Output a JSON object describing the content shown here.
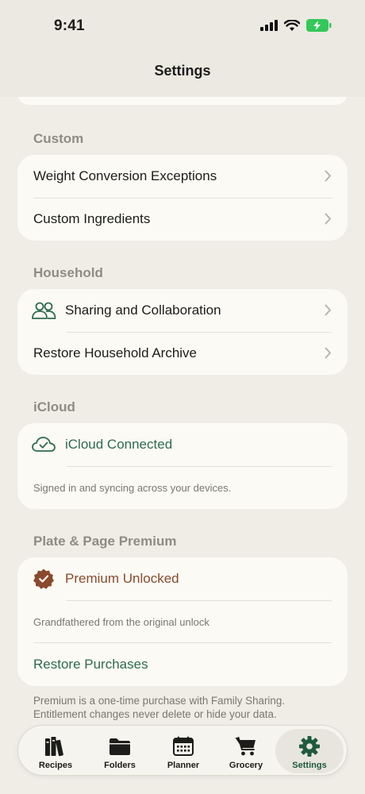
{
  "status": {
    "time": "9:41"
  },
  "nav": {
    "title": "Settings"
  },
  "sections": {
    "custom": {
      "header": "Custom",
      "rows": [
        "Weight Conversion Exceptions",
        "Custom Ingredients"
      ]
    },
    "household": {
      "header": "Household",
      "rows": [
        "Sharing and Collaboration",
        "Restore Household Archive"
      ]
    },
    "icloud": {
      "header": "iCloud",
      "status": "iCloud Connected",
      "caption": "Signed in and syncing across your devices."
    },
    "premium": {
      "header": "Plate & Page Premium",
      "status": "Premium Unlocked",
      "caption": "Grandfathered from the original unlock",
      "restore": "Restore Purchases",
      "footer": "Premium is a one-time purchase with Family Sharing. Entitlement changes never delete or hide your data."
    }
  },
  "tabs": [
    {
      "label": "Recipes",
      "icon": "books-icon"
    },
    {
      "label": "Folders",
      "icon": "folder-icon"
    },
    {
      "label": "Planner",
      "icon": "calendar-icon"
    },
    {
      "label": "Grocery",
      "icon": "cart-icon"
    },
    {
      "label": "Settings",
      "icon": "gear-icon",
      "active": true
    }
  ],
  "colors": {
    "accent_green": "#2f6b50",
    "accent_brown": "#8a4a2e",
    "battery_green": "#34c759"
  }
}
